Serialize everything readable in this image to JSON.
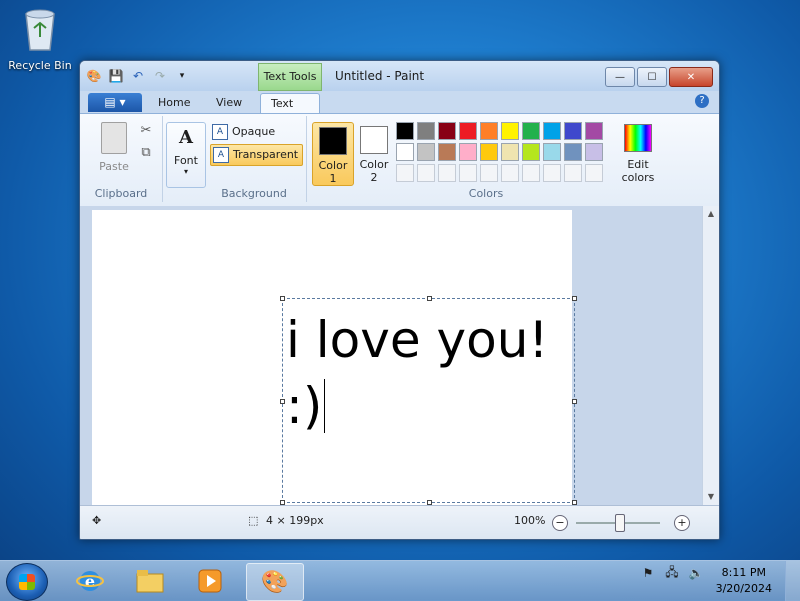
{
  "desktop": {
    "recycle_bin": "Recycle Bin"
  },
  "window": {
    "title": "Untitled - Paint",
    "contextual_tab": "Text Tools",
    "controls": {
      "minimize": "—",
      "maximize": "☐",
      "close": "✕"
    }
  },
  "ribbon": {
    "tabs": [
      "Home",
      "View",
      "Text"
    ],
    "active_tab": "Text",
    "help": "?",
    "clipboard": {
      "paste": "Paste",
      "group": "Clipboard"
    },
    "font": {
      "glyph": "A",
      "label": "Font"
    },
    "background": {
      "opaque": "Opaque",
      "transparent": "Transparent",
      "group": "Background"
    },
    "colors": {
      "color1_label": "Color",
      "color1_num": "1",
      "color2_label": "Color",
      "color2_num": "2",
      "edit": "Edit",
      "edit2": "colors",
      "group": "Colors",
      "color1_value": "#000000",
      "color2_value": "#ffffff",
      "row1": [
        "#000000",
        "#7f7f7f",
        "#880015",
        "#ed1c24",
        "#ff7f27",
        "#fff200",
        "#22b14c",
        "#00a2e8",
        "#3f48cc",
        "#a349a4"
      ],
      "row2": [
        "#ffffff",
        "#c3c3c3",
        "#b97a57",
        "#ffaec9",
        "#ffc90e",
        "#efe4b0",
        "#b5e61d",
        "#99d9ea",
        "#7092be",
        "#c8bfe7"
      ]
    }
  },
  "canvas": {
    "line1": "i love you!",
    "line2": ":)"
  },
  "status": {
    "size": "4 × 199px",
    "zoom": "100%"
  },
  "taskbar": {
    "time": "8:11 PM",
    "date": "3/20/2024"
  }
}
